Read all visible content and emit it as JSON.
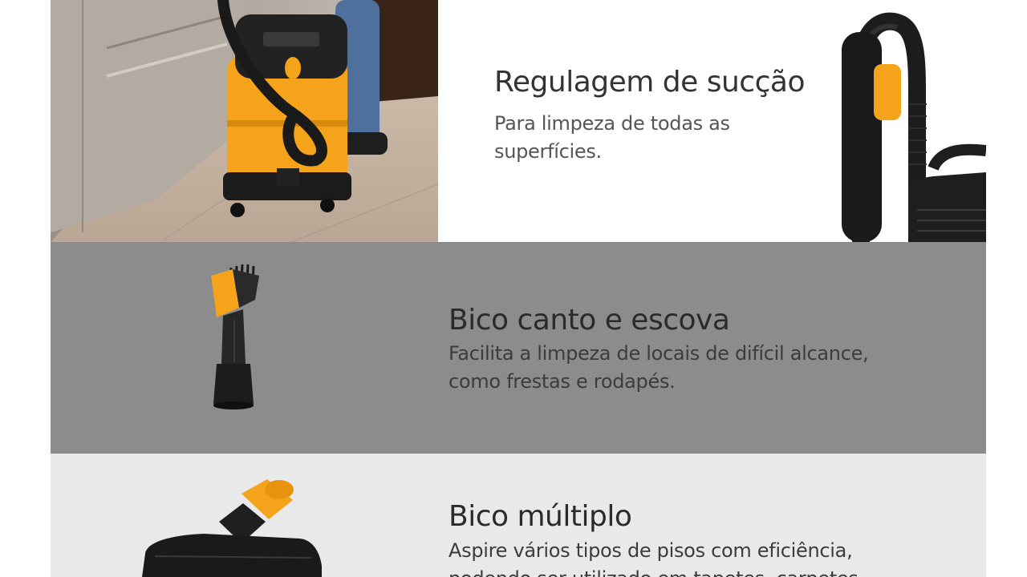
{
  "features": [
    {
      "title": "Regulagem de sucção",
      "description": "Para limpeza de todas as superfícies."
    },
    {
      "title": "Bico canto e escova",
      "description": "Facilita a limpeza de locais de difícil alcance, como frestas e rodapés."
    },
    {
      "title": "Bico múltiplo",
      "description": "Aspire vários tipos de pisos com eficiência, podendo ser utilizado em tapetes, carpetes"
    }
  ],
  "colors": {
    "brand_yellow": "#f5a31a",
    "section_gray": "#8c8c8c",
    "section_light": "#e9e9e9"
  },
  "icons": [
    "vacuum-cleaner-photo",
    "hose-suction-control-image",
    "corner-brush-nozzle-image",
    "multi-floor-nozzle-image"
  ]
}
